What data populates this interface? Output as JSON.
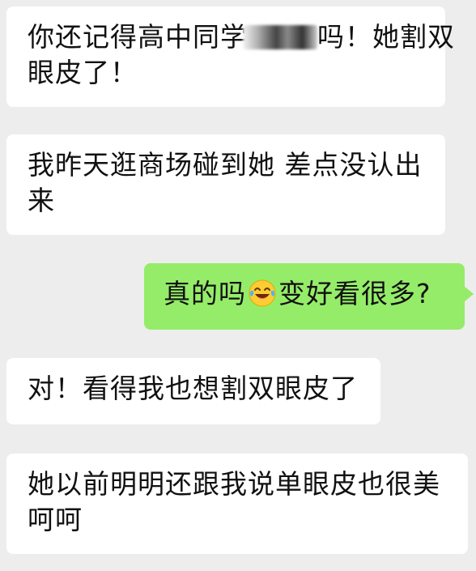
{
  "messages": [
    {
      "side": "incoming",
      "line1_before": "你还记得高中同学",
      "line1_after": "吗！她割双",
      "line2": "眼皮了！"
    },
    {
      "side": "incoming",
      "line1": "我昨天逛商场碰到她 差点没认出",
      "line2": "来"
    },
    {
      "side": "outgoing",
      "before_emoji": "真的吗",
      "emoji": "face-with-tears-of-joy-icon",
      "after_emoji": "变好看很多?"
    },
    {
      "side": "incoming",
      "text": "对！看得我也想割双眼皮了"
    },
    {
      "side": "incoming",
      "line1": "她以前明明还跟我说单眼皮也很美",
      "line2": "呵呵"
    }
  ],
  "colors": {
    "background": "#ededed",
    "incoming_bubble": "#ffffff",
    "outgoing_bubble": "#95ec69",
    "text": "#111111"
  }
}
